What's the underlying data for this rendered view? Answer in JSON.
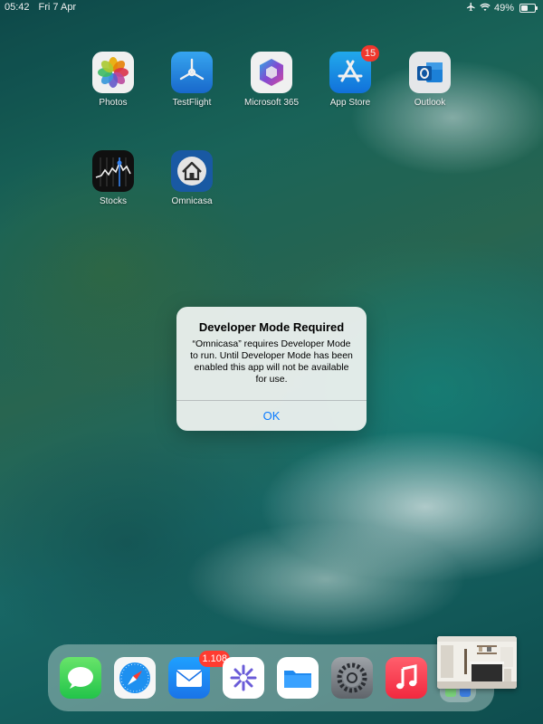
{
  "status_bar": {
    "time": "05:42",
    "date": "Fri 7 Apr",
    "battery_percent": "49%",
    "battery_level": 0.49,
    "icons": [
      "airplane-icon",
      "wifi-icon",
      "battery-icon"
    ]
  },
  "home_apps": [
    {
      "label": "Photos",
      "icon": "photos-icon"
    },
    {
      "label": "TestFlight",
      "icon": "testflight-icon"
    },
    {
      "label": "Microsoft 365",
      "icon": "microsoft-365-icon"
    },
    {
      "label": "App Store",
      "icon": "app-store-icon",
      "badge": "15"
    },
    {
      "label": "Outlook",
      "icon": "outlook-icon"
    },
    {
      "label": "Stocks",
      "icon": "stocks-icon"
    },
    {
      "label": "Omnicasa",
      "icon": "omnicasa-icon"
    }
  ],
  "alert": {
    "title": "Developer Mode Required",
    "message": "“Omnicasa” requires Developer Mode to run. Until Developer Mode has been enabled this app will not be available for use.",
    "button": "OK"
  },
  "dock": {
    "apps": [
      {
        "icon": "messages-icon"
      },
      {
        "icon": "safari-icon"
      },
      {
        "icon": "mail-icon",
        "badge": "1.108"
      },
      {
        "icon": "perplexity-icon"
      },
      {
        "icon": "files-icon"
      },
      {
        "icon": "settings-icon"
      },
      {
        "icon": "music-icon"
      },
      {
        "icon": "app-library-icon"
      }
    ]
  },
  "colors": {
    "badge": "#ff3b30",
    "alert_button": "#0a7aff"
  }
}
